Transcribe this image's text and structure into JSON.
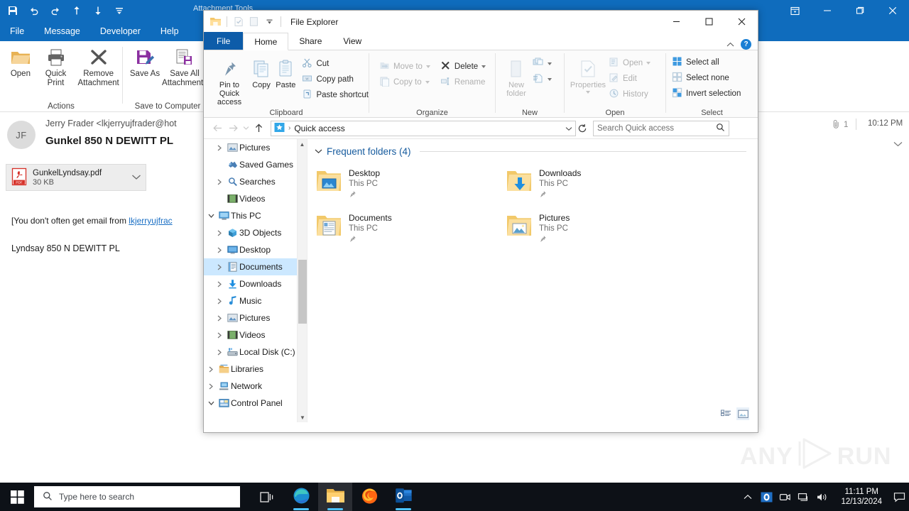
{
  "outlook": {
    "window_title": "Attachment Tools",
    "quick_access_icons": [
      "save-icon",
      "undo-icon",
      "redo-icon",
      "move-up-icon",
      "move-down-icon",
      "customize-qat-icon"
    ],
    "window_buttons": [
      "ribbon-display-options",
      "minimize",
      "maximize",
      "close"
    ],
    "menu": [
      {
        "label": "File"
      },
      {
        "label": "Message"
      },
      {
        "label": "Developer"
      },
      {
        "label": "Help"
      }
    ],
    "ribbon_groups": [
      {
        "label": "Actions",
        "buttons": [
          {
            "label": "Open",
            "icon": "open-folder-icon"
          },
          {
            "label": "Quick Print",
            "icon": "printer-icon"
          },
          {
            "label": "Remove Attachment",
            "icon": "remove-x-icon"
          }
        ]
      },
      {
        "label": "Save to Computer",
        "buttons": [
          {
            "label": "Save As",
            "icon": "save-as-icon"
          },
          {
            "label": "Save All Attachments",
            "icon": "save-all-icon"
          }
        ]
      }
    ],
    "message": {
      "avatar_initials": "JF",
      "from": "Jerry Frader <lkjerryujfrader@hot",
      "subject": "Gunkel 850 N DEWITT PL",
      "attachment_count": "1",
      "received_time": "10:12 PM",
      "attachment": {
        "file_name": "GunkelLyndsay.pdf",
        "file_size": "30 KB",
        "file_type": "PDF"
      },
      "body_warning_prefix": "[You don't often get email from ",
      "body_warning_link": "lkjerryujfrac",
      "body_line": "Lyndsay 850  N DEWITT PL"
    }
  },
  "explorer": {
    "title": "File Explorer",
    "quick_access_icons": [
      "explorer-icon",
      "properties-icon",
      "new-folder-icon",
      "customize-qat-icon"
    ],
    "window_buttons": [
      "minimize",
      "maximize",
      "close"
    ],
    "tabs": [
      {
        "label": "File"
      },
      {
        "label": "Home"
      },
      {
        "label": "Share"
      },
      {
        "label": "View"
      }
    ],
    "active_tab": "Home",
    "help_label": "?",
    "ribbon_groups": [
      {
        "label": "Clipboard",
        "large_buttons": [
          {
            "label": "Pin to Quick access",
            "icon": "pin-icon"
          },
          {
            "label": "Copy",
            "icon": "copy-icon"
          },
          {
            "label": "Paste",
            "icon": "paste-icon"
          }
        ],
        "small_buttons": [
          {
            "label": "Cut",
            "icon": "scissors-icon"
          },
          {
            "label": "Copy path",
            "icon": "copy-path-icon"
          },
          {
            "label": "Paste shortcut",
            "icon": "paste-shortcut-icon"
          }
        ]
      },
      {
        "label": "Organize",
        "small_buttons": [
          {
            "label": "Move to",
            "icon": "move-to-icon",
            "has_dropdown": true,
            "disabled": true
          },
          {
            "label": "Copy to",
            "icon": "copy-to-icon",
            "has_dropdown": true,
            "disabled": true
          },
          {
            "label": "Delete",
            "icon": "delete-x-icon",
            "has_dropdown": true,
            "disabled": false
          },
          {
            "label": "Rename",
            "icon": "rename-icon",
            "disabled": true
          }
        ]
      },
      {
        "label": "New",
        "large_buttons": [
          {
            "label": "New folder",
            "icon": "new-folder-icon"
          }
        ],
        "small_buttons": [
          {
            "label": "",
            "icon": "new-item-icon",
            "has_dropdown": true
          },
          {
            "label": "",
            "icon": "easy-access-icon",
            "has_dropdown": true
          }
        ]
      },
      {
        "label": "Open",
        "large_buttons": [
          {
            "label": "Properties",
            "icon": "properties-icon",
            "has_dropdown": true,
            "disabled": true
          }
        ],
        "small_buttons": [
          {
            "label": "Open",
            "icon": "open-icon",
            "has_dropdown": true,
            "disabled": true
          },
          {
            "label": "Edit",
            "icon": "edit-icon",
            "disabled": true
          },
          {
            "label": "History",
            "icon": "history-icon",
            "disabled": true
          }
        ]
      },
      {
        "label": "Select",
        "small_buttons": [
          {
            "label": "Select all",
            "icon": "select-all-icon"
          },
          {
            "label": "Select none",
            "icon": "select-none-icon"
          },
          {
            "label": "Invert selection",
            "icon": "invert-selection-icon"
          }
        ]
      }
    ],
    "address_bar": {
      "back_icon": "back-arrow-icon",
      "forward_icon": "forward-arrow-icon",
      "recent_icon": "recent-locations-icon",
      "up_icon": "up-arrow-icon",
      "location_icon": "quick-access-star-icon",
      "path": "Quick access",
      "dropdown_icon": "chevron-down-icon",
      "refresh_icon": "refresh-icon"
    },
    "search": {
      "placeholder": "Search Quick access",
      "value": "",
      "icon": "search-icon"
    },
    "nav_tree": [
      {
        "label": "Pictures",
        "icon": "pictures-icon",
        "indent": 1,
        "chevron": "collapsed",
        "selected": false
      },
      {
        "label": "Saved Games",
        "icon": "saved-games-icon",
        "indent": 1,
        "chevron": "none",
        "selected": false
      },
      {
        "label": "Searches",
        "icon": "searches-icon",
        "indent": 1,
        "chevron": "collapsed",
        "selected": false
      },
      {
        "label": "Videos",
        "icon": "videos-icon",
        "indent": 1,
        "chevron": "none",
        "selected": false
      },
      {
        "label": "This PC",
        "icon": "this-pc-icon",
        "indent": 0,
        "chevron": "expanded",
        "selected": false
      },
      {
        "label": "3D Objects",
        "icon": "3d-objects-icon",
        "indent": 1,
        "chevron": "collapsed",
        "selected": false
      },
      {
        "label": "Desktop",
        "icon": "desktop-icon",
        "indent": 1,
        "chevron": "collapsed",
        "selected": false
      },
      {
        "label": "Documents",
        "icon": "documents-icon",
        "indent": 1,
        "chevron": "collapsed",
        "selected": true
      },
      {
        "label": "Downloads",
        "icon": "downloads-icon",
        "indent": 1,
        "chevron": "collapsed",
        "selected": false
      },
      {
        "label": "Music",
        "icon": "music-icon",
        "indent": 1,
        "chevron": "collapsed",
        "selected": false
      },
      {
        "label": "Pictures",
        "icon": "pictures-icon",
        "indent": 1,
        "chevron": "collapsed",
        "selected": false
      },
      {
        "label": "Videos",
        "icon": "videos-icon",
        "indent": 1,
        "chevron": "collapsed",
        "selected": false
      },
      {
        "label": "Local Disk (C:)",
        "icon": "local-disk-icon",
        "indent": 1,
        "chevron": "collapsed",
        "selected": false
      },
      {
        "label": "Libraries",
        "icon": "libraries-icon",
        "indent": 0,
        "chevron": "collapsed",
        "selected": false
      },
      {
        "label": "Network",
        "icon": "network-icon",
        "indent": 0,
        "chevron": "collapsed",
        "selected": false
      },
      {
        "label": "Control Panel",
        "icon": "control-panel-icon",
        "indent": 0,
        "chevron": "expanded",
        "selected": false
      }
    ],
    "content": {
      "section_title": "Frequent folders (4)",
      "items": [
        {
          "name": "Desktop",
          "location": "This PC",
          "icon": "folder-desktop-icon",
          "pinned": true
        },
        {
          "name": "Downloads",
          "location": "This PC",
          "icon": "folder-downloads-icon",
          "pinned": true
        },
        {
          "name": "Documents",
          "location": "This PC",
          "icon": "folder-documents-icon",
          "pinned": true
        },
        {
          "name": "Pictures",
          "location": "This PC",
          "icon": "folder-pictures-icon",
          "pinned": true
        }
      ]
    },
    "status_bar": {
      "view_buttons": [
        {
          "name": "details-view-button",
          "active": false
        },
        {
          "name": "large-icons-view-button",
          "active": true
        }
      ]
    }
  },
  "watermark": {
    "text_left": "ANY",
    "text_right": "RUN"
  },
  "taskbar": {
    "start_icon": "windows-start-icon",
    "search": {
      "placeholder": "Type here to search",
      "icon": "search-icon"
    },
    "task_view_icon": "task-view-icon",
    "apps": [
      {
        "name": "microsoft-edge",
        "icon": "edge-icon",
        "running": true,
        "active": false
      },
      {
        "name": "file-explorer",
        "icon": "file-explorer-icon",
        "running": true,
        "active": true
      },
      {
        "name": "mozilla-firefox",
        "icon": "firefox-icon",
        "running": false,
        "active": false
      },
      {
        "name": "microsoft-outlook",
        "icon": "outlook-icon",
        "running": true,
        "active": false
      }
    ],
    "tray": [
      {
        "name": "show-hidden-icons",
        "icon": "chevron-up-icon"
      },
      {
        "name": "outlook-tray",
        "icon": "outlook-icon"
      },
      {
        "name": "meet-now",
        "icon": "camera-icon"
      },
      {
        "name": "network",
        "icon": "network-icon"
      },
      {
        "name": "volume",
        "icon": "speaker-icon"
      }
    ],
    "clock": {
      "time": "11:11 PM",
      "date": "12/13/2024"
    },
    "notification_icon": "notification-icon"
  },
  "colors": {
    "outlook_blue": "#0f6cbd",
    "explorer_file_tab": "#0d5ca9",
    "selection_blue": "#cce8ff",
    "taskbar": "#0d1117",
    "link": "#1a6fc4",
    "section_title": "#165b9e"
  }
}
